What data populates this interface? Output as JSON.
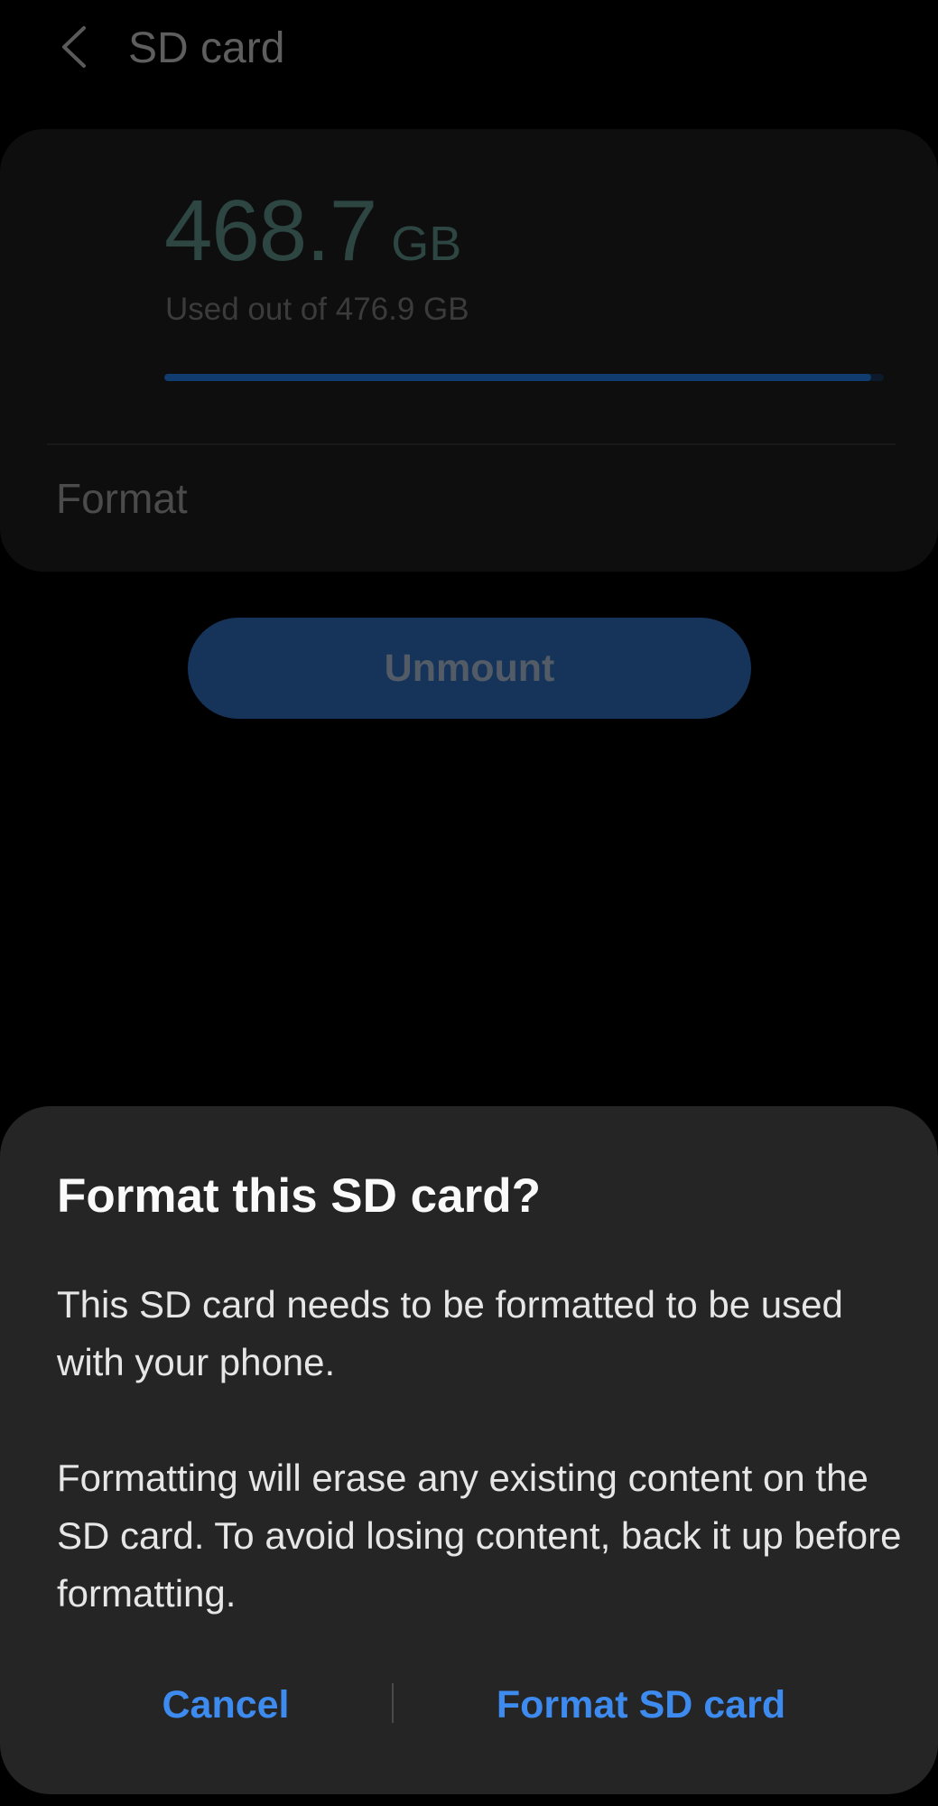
{
  "app_bar": {
    "back_icon": "chevron-left-icon",
    "title": "SD card"
  },
  "storage": {
    "used_value": "468.7",
    "used_unit": "GB",
    "caption": "Used out of 476.9 GB",
    "used_fraction": 0.983,
    "format_label": "Format"
  },
  "unmount_label": "Unmount",
  "dialog": {
    "title": "Format this SD card?",
    "paragraph_1": "This SD card needs to be formatted to be used with your phone.",
    "paragraph_2": "Formatting will erase any existing content on the SD card. To avoid losing content, back it up before formatting.",
    "cancel_label": "Cancel",
    "confirm_label": "Format SD card"
  },
  "colors": {
    "background": "#000000",
    "dialog_background": "#252525",
    "accent_blue": "#3e8bf0",
    "unmount_button": "#16335a",
    "progress_fill": "#103c70"
  }
}
